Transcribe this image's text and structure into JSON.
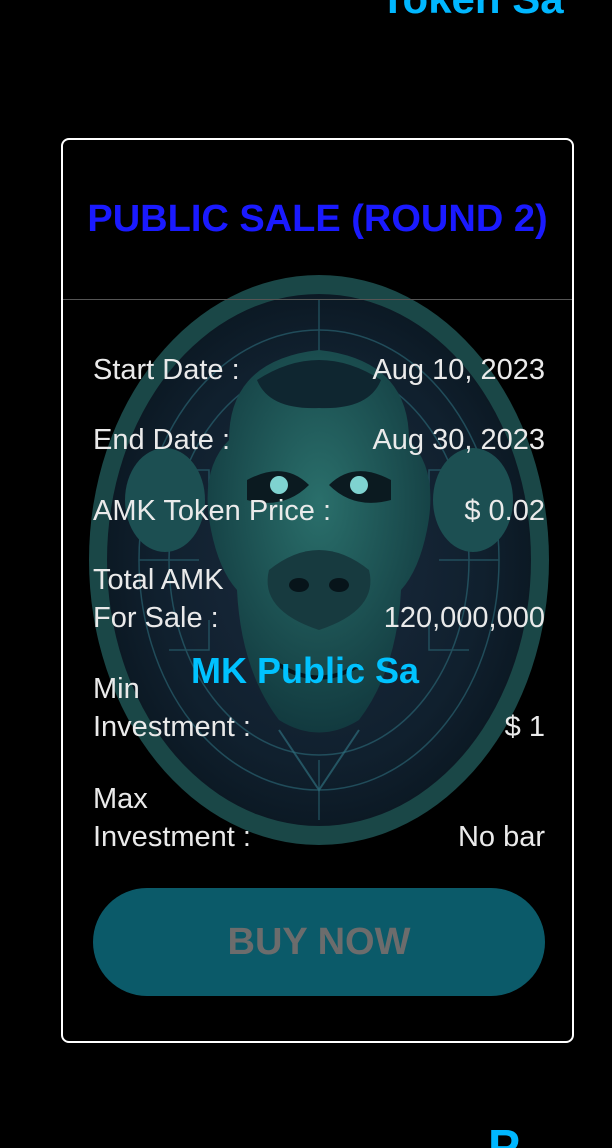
{
  "page": {
    "top_heading": "Token Sa",
    "bottom_heading": "P"
  },
  "card": {
    "title": "PUBLIC SALE (ROUND 2)",
    "overlay_text": "MK Public Sa",
    "details": [
      {
        "label": "Start Date :",
        "value": "Aug 10, 2023"
      },
      {
        "label": "End Date :",
        "value": "Aug 30, 2023"
      },
      {
        "label": "AMK Token Price :",
        "value": "$ 0.02"
      },
      {
        "label": "Total AMK For Sale :",
        "value": "120,000,000"
      },
      {
        "label": "Min Investment :",
        "value": "$ 1"
      },
      {
        "label": "Max Investment :",
        "value": "No bar"
      }
    ],
    "buy_button_label": "BUY NOW"
  },
  "colors": {
    "heading_cyan": "#00b7ff",
    "card_title_blue": "#1a1aff",
    "button_bg": "#0b5a69",
    "button_text": "#6c6c6c"
  },
  "icons": {
    "background_art": "monkey-coin-icon"
  }
}
